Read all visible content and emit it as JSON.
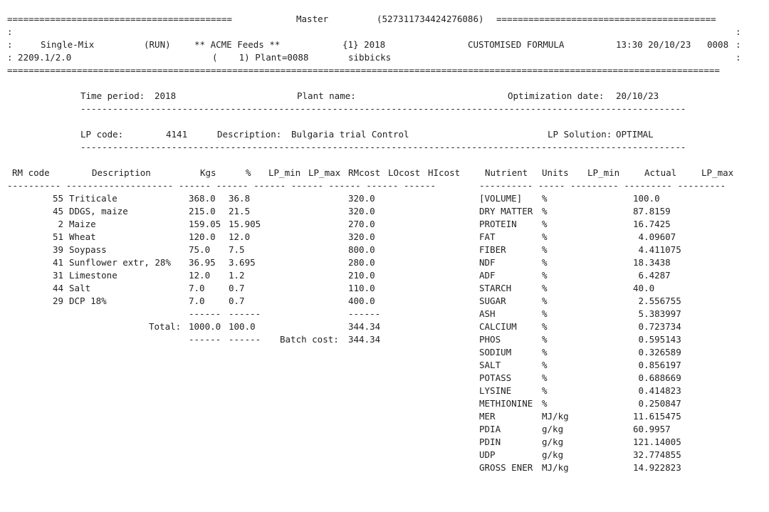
{
  "header": {
    "rule_left": "==========================================",
    "title": "Master",
    "id": "(527311734424276086)",
    "rule_right": "=========================================",
    "edge_left": ":",
    "edge_right": ":",
    "mode": "Single-Mix",
    "status": "(RUN)",
    "company": "** ACME Feeds **",
    "period_code": "{1} 2018",
    "formula_type": "CUSTOMISED FORMULA",
    "datetime": "13:30 20/10/23",
    "counter": "0008",
    "version": ": 2209.1/2.0",
    "plant_ref": "(    1) Plant=0088",
    "user": "sibbicks",
    "rule_full": "====================================================================================================================================="
  },
  "info": {
    "time_period_label": "Time period:",
    "time_period": "2018",
    "plant_name_label": "Plant name:",
    "plant_name": "",
    "opt_date_label": "Optimization date:",
    "opt_date": "20/10/23",
    "lp_code_label": "LP code:",
    "lp_code": "4141",
    "description_label": "Description:",
    "description": "Bulgaria trial Control",
    "lp_solution_label": "LP Solution:",
    "lp_solution": "OPTIMAL",
    "divider": "-----------------------------------------------------------------------------------------------------------------"
  },
  "rm_table": {
    "headers": {
      "code": "RM code",
      "description": "Description",
      "kgs": "Kgs",
      "pct": "%",
      "lp_min": "LP_min",
      "lp_max": "LP_max",
      "rmcost": "RMcost",
      "locost": "LOcost",
      "hicost": "HIcost"
    },
    "divider": "---------- -------------------- ------ ------ ------ ------ ------ ------ ------",
    "rows": [
      {
        "code": "55",
        "description": "Triticale",
        "kgs": "368.0",
        "pct": "36.8",
        "rmcost": "320.0"
      },
      {
        "code": "45",
        "description": "DDGS, maize",
        "kgs": "215.0",
        "pct": "21.5",
        "rmcost": "320.0"
      },
      {
        "code": "2",
        "description": "Maize",
        "kgs": "159.05",
        "pct": "15.905",
        "rmcost": "270.0"
      },
      {
        "code": "51",
        "description": "Wheat",
        "kgs": "120.0",
        "pct": "12.0",
        "rmcost": "320.0"
      },
      {
        "code": "39",
        "description": "Soypass",
        "kgs": "75.0",
        "pct": "7.5",
        "rmcost": "800.0"
      },
      {
        "code": "41",
        "description": "Sunflower extr, 28%",
        "kgs": "36.95",
        "pct": "3.695",
        "rmcost": "280.0"
      },
      {
        "code": "31",
        "description": "Limestone",
        "kgs": "12.0",
        "pct": "1.2",
        "rmcost": "210.0"
      },
      {
        "code": "44",
        "description": "Salt",
        "kgs": "7.0",
        "pct": "0.7",
        "rmcost": "110.0"
      },
      {
        "code": "29",
        "description": "DCP 18%",
        "kgs": "7.0",
        "pct": "0.7",
        "rmcost": "400.0"
      }
    ],
    "sum_dash_kgs": "------",
    "sum_dash_pct": "------",
    "sum_dash_cost": "------",
    "total_label": "Total:",
    "total_kgs": "1000.0",
    "total_pct": "100.0",
    "total_cost": "344.34",
    "batch_cost_label": "Batch cost:",
    "batch_cost": "344.34"
  },
  "nutrient_table": {
    "headers": {
      "nutrient": "Nutrient",
      "units": "Units",
      "lp_min": "LP_min",
      "actual": "Actual",
      "lp_max": "LP_max"
    },
    "divider": "---------- ----- --------- --------- ---------",
    "rows": [
      {
        "name": "[VOLUME]",
        "units": "%",
        "actual": "100.0"
      },
      {
        "name": "DRY MATTER",
        "units": "%",
        "actual": "87.8159"
      },
      {
        "name": "PROTEIN",
        "units": "%",
        "actual": "16.7425"
      },
      {
        "name": "FAT",
        "units": "%",
        "actual": " 4.09607"
      },
      {
        "name": "FIBER",
        "units": "%",
        "actual": " 4.411075"
      },
      {
        "name": "NDF",
        "units": "%",
        "actual": "18.3438"
      },
      {
        "name": "ADF",
        "units": "%",
        "actual": " 6.4287"
      },
      {
        "name": "STARCH",
        "units": "%",
        "actual": "40.0"
      },
      {
        "name": "SUGAR",
        "units": "%",
        "actual": " 2.556755"
      },
      {
        "name": "ASH",
        "units": "%",
        "actual": " 5.383997"
      },
      {
        "name": "CALCIUM",
        "units": "%",
        "actual": " 0.723734"
      },
      {
        "name": "PHOS",
        "units": "%",
        "actual": " 0.595143"
      },
      {
        "name": "SODIUM",
        "units": "%",
        "actual": " 0.326589"
      },
      {
        "name": "SALT",
        "units": "%",
        "actual": " 0.856197"
      },
      {
        "name": "POTASS",
        "units": "%",
        "actual": " 0.688669"
      },
      {
        "name": "LYSINE",
        "units": "%",
        "actual": " 0.414823"
      },
      {
        "name": "METHIONINE",
        "units": "%",
        "actual": " 0.250847"
      },
      {
        "name": "MER",
        "units": "MJ/kg",
        "actual": "11.615475"
      },
      {
        "name": "PDIA",
        "units": "g/kg",
        "actual": "60.9957"
      },
      {
        "name": "PDIN",
        "units": "g/kg",
        "actual": "121.14005"
      },
      {
        "name": "UDP",
        "units": "g/kg",
        "actual": "32.774855"
      },
      {
        "name": "GROSS ENER",
        "units": "MJ/kg",
        "actual": "14.922823"
      }
    ]
  }
}
